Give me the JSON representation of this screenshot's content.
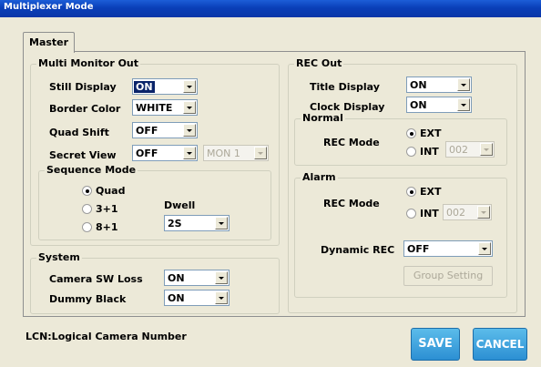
{
  "window": {
    "title": "Multiplexer Mode"
  },
  "tab": {
    "label": "Master"
  },
  "multi_monitor_out": {
    "title": "Multi Monitor Out",
    "still_display": {
      "label": "Still Display",
      "value": "ON"
    },
    "border_color": {
      "label": "Border Color",
      "value": "WHITE"
    },
    "quad_shift": {
      "label": "Quad Shift",
      "value": "OFF"
    },
    "secret_view": {
      "label": "Secret View",
      "value": "OFF",
      "monitor": "MON 1"
    },
    "sequence_mode": {
      "title": "Sequence Mode",
      "options": [
        "Quad",
        "3+1",
        "8+1"
      ],
      "selected": "Quad",
      "dwell_label": "Dwell",
      "dwell_value": "2S"
    }
  },
  "system": {
    "title": "System",
    "camera_sw_loss": {
      "label": "Camera SW Loss",
      "value": "ON"
    },
    "dummy_black": {
      "label": "Dummy Black",
      "value": "ON"
    }
  },
  "rec_out": {
    "title": "REC Out",
    "title_display": {
      "label": "Title Display",
      "value": "ON"
    },
    "clock_display": {
      "label": "Clock Display",
      "value": "ON"
    },
    "normal": {
      "title": "Normal",
      "rec_mode_label": "REC Mode",
      "options": [
        "EXT",
        "INT"
      ],
      "selected": "EXT",
      "int_value": "002"
    },
    "alarm": {
      "title": "Alarm",
      "rec_mode_label": "REC Mode",
      "options": [
        "EXT",
        "INT"
      ],
      "selected": "EXT",
      "int_value": "002",
      "dynamic_rec_label": "Dynamic REC",
      "dynamic_rec_value": "OFF",
      "group_setting_label": "Group Setting"
    }
  },
  "footer": {
    "note": "LCN:Logical Camera Number",
    "save_label": "SAVE",
    "cancel_label": "CANCEL"
  }
}
